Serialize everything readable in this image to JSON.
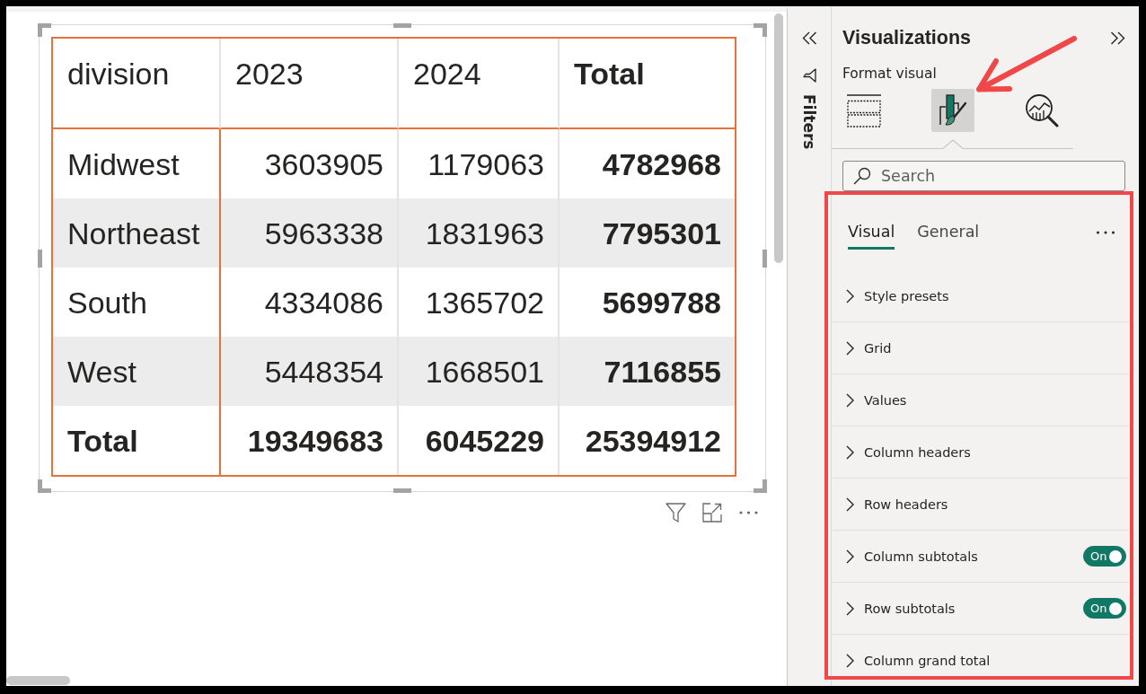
{
  "report_canvas": {
    "table": {
      "columns": [
        {
          "label": "division",
          "kind": "row_header"
        },
        {
          "label": "2023",
          "kind": "value"
        },
        {
          "label": "2024",
          "kind": "value"
        },
        {
          "label": "Total",
          "kind": "total"
        }
      ],
      "rows": [
        {
          "kind": "data",
          "cells": [
            "Midwest",
            "3603905",
            "1179063",
            "4782968"
          ]
        },
        {
          "kind": "data",
          "cells": [
            "Northeast",
            "5963338",
            "1831963",
            "7795301"
          ]
        },
        {
          "kind": "data",
          "cells": [
            "South",
            "4334086",
            "1365702",
            "5699788"
          ]
        },
        {
          "kind": "data",
          "cells": [
            "West",
            "5448354",
            "1668501",
            "7116855"
          ]
        },
        {
          "kind": "total",
          "cells": [
            "Total",
            "19349683",
            "6045229",
            "25394912"
          ]
        }
      ]
    }
  },
  "filters_pane": {
    "label": "Filters"
  },
  "visualizations_pane": {
    "title": "Visualizations",
    "subtitle": "Format visual",
    "icon_tabs": [
      {
        "kind": "build",
        "selected": false
      },
      {
        "kind": "format",
        "selected": true
      },
      {
        "kind": "analytics",
        "selected": false
      }
    ],
    "search": {
      "placeholder": "Search"
    },
    "format_options": {
      "tabs": [
        {
          "label": "Visual",
          "selected": true
        },
        {
          "label": "General",
          "selected": false
        }
      ],
      "sections": [
        {
          "label": "Style presets",
          "expanded": false
        },
        {
          "label": "Grid",
          "expanded": false
        },
        {
          "label": "Values",
          "expanded": false
        },
        {
          "label": "Column headers",
          "expanded": false
        },
        {
          "label": "Row headers",
          "expanded": false
        },
        {
          "label": "Column subtotals",
          "expanded": false,
          "toggle": {
            "on": true,
            "label": "On"
          }
        },
        {
          "label": "Row subtotals",
          "expanded": false,
          "toggle": {
            "on": true,
            "label": "On"
          }
        },
        {
          "label": "Column grand total",
          "expanded": false
        }
      ]
    }
  },
  "annotations": {
    "arrow": true,
    "highlight_box": true
  }
}
